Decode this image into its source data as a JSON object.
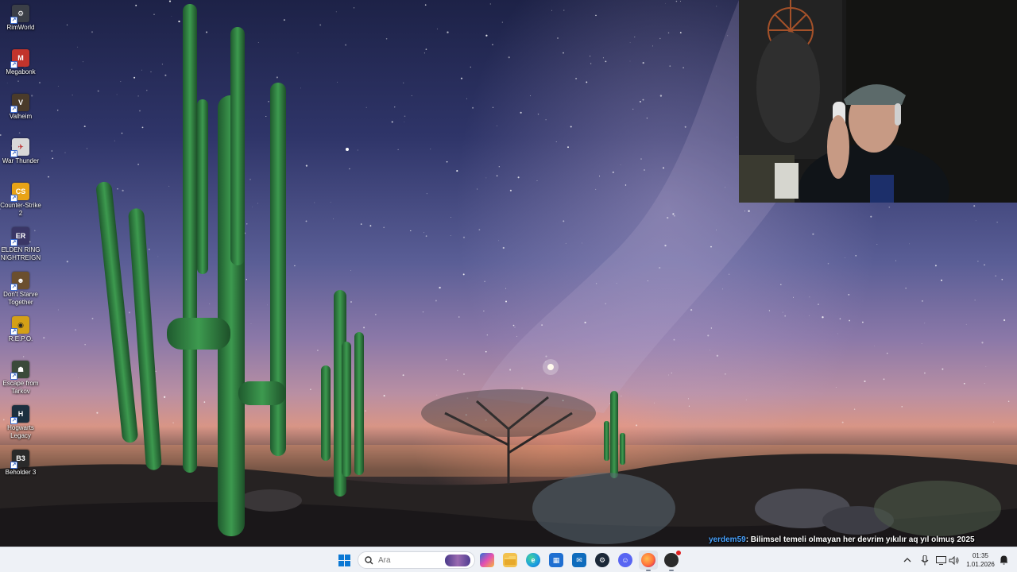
{
  "desktop": {
    "icons": [
      {
        "label": "RimWorld",
        "icon": "rimworld-icon",
        "color": "#3b3f47"
      },
      {
        "label": "Megabonk",
        "icon": "megabonk-icon",
        "color": "#c2342c"
      },
      {
        "label": "Valheim",
        "icon": "valheim-icon",
        "color": "#4a3b2a"
      },
      {
        "label": "War Thunder",
        "icon": "war-thunder-icon",
        "color": "#d8d8d8"
      },
      {
        "label": "Counter-Strike 2",
        "icon": "counter-strike-2-icon",
        "color": "#e8a317"
      },
      {
        "label": "ELDEN RING NIGHTREIGN",
        "icon": "elden-ring-nightreign-icon",
        "color": "#3a3666"
      },
      {
        "label": "Don't Starve Together",
        "icon": "dont-starve-together-icon",
        "color": "#6b4f2e"
      },
      {
        "label": "R.E.P.O.",
        "icon": "repo-icon",
        "color": "#d4a017"
      },
      {
        "label": "Escape from Tarkov",
        "icon": "escape-from-tarkov-icon",
        "color": "#3b4a3a"
      },
      {
        "label": "Hogwarts Legacy",
        "icon": "hogwarts-legacy-icon",
        "color": "#1c2f3f"
      },
      {
        "label": "Beholder 3",
        "icon": "beholder-3-icon",
        "color": "#2a2a2a"
      }
    ]
  },
  "chat": {
    "username": "yerdem59",
    "message": ": Bilimsel temeli olmayan her devrim yıkılır aq yıl olmuş 2025"
  },
  "taskbar": {
    "search_placeholder": "Ara",
    "apps": [
      {
        "name": "copilot",
        "color": "#2b6fd6"
      },
      {
        "name": "file-explorer",
        "color": "#f2c14e"
      },
      {
        "name": "edge",
        "color": "#1b9de2"
      },
      {
        "name": "microsoft-store",
        "color": "#1f6fd1"
      },
      {
        "name": "outlook",
        "color": "#0f6cbd"
      },
      {
        "name": "steam",
        "color": "#1b2838"
      },
      {
        "name": "discord",
        "color": "#5865f2"
      },
      {
        "name": "firefox",
        "color": "#ff7139"
      },
      {
        "name": "obs",
        "color": "#2a2a2a"
      }
    ],
    "clock_time": "01:35",
    "clock_date": "1.01.2026"
  }
}
